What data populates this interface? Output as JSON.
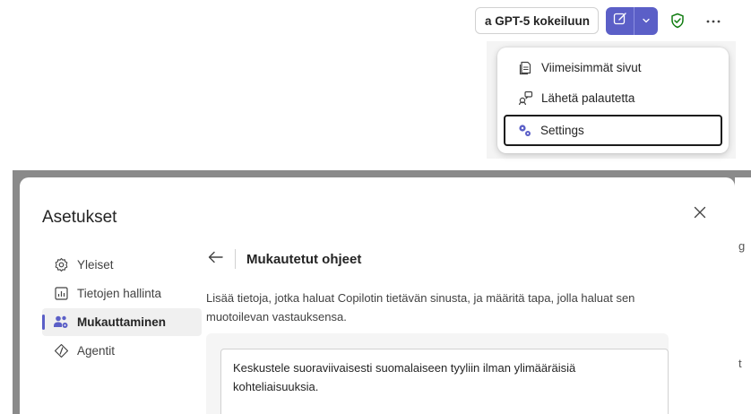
{
  "toolbar": {
    "try_label": "a GPT-5 kokeiluun",
    "new_chat_icon": "compose-icon",
    "dropdown_icon": "chevron-down-icon",
    "shield_icon": "shield-check-icon",
    "more_icon": "more-horizontal-icon"
  },
  "menu": {
    "items": [
      {
        "label": "Viimeisimmät sivut",
        "icon": "pages-icon"
      },
      {
        "label": "Lähetä palautetta",
        "icon": "feedback-icon"
      },
      {
        "label": "Settings",
        "icon": "settings-gear-icon"
      }
    ]
  },
  "dialog": {
    "title": "Asetukset",
    "nav": [
      {
        "label": "Yleiset",
        "icon": "gear-icon",
        "active": false
      },
      {
        "label": "Tietojen hallinta",
        "icon": "data-chart-icon",
        "active": false
      },
      {
        "label": "Mukauttaminen",
        "icon": "people-settings-icon",
        "active": true
      },
      {
        "label": "Agentit",
        "icon": "agent-icon",
        "active": false
      }
    ],
    "content": {
      "title": "Mukautetut ohjeet",
      "description": "Lisää tietoja, jotka haluat Copilotin tietävän sinusta, ja määritä tapa, jolla haluat sen muotoilevan vastauksensa.",
      "instructions_value": "Keskustele suoraviivaisesti suomalaiseen tyyliin ilman ylimääräisiä kohteliaisuuksia."
    }
  },
  "background_fragments": [
    "g",
    "t"
  ],
  "colors": {
    "accent": "#5b5fc7",
    "shield_green": "#107c10"
  }
}
